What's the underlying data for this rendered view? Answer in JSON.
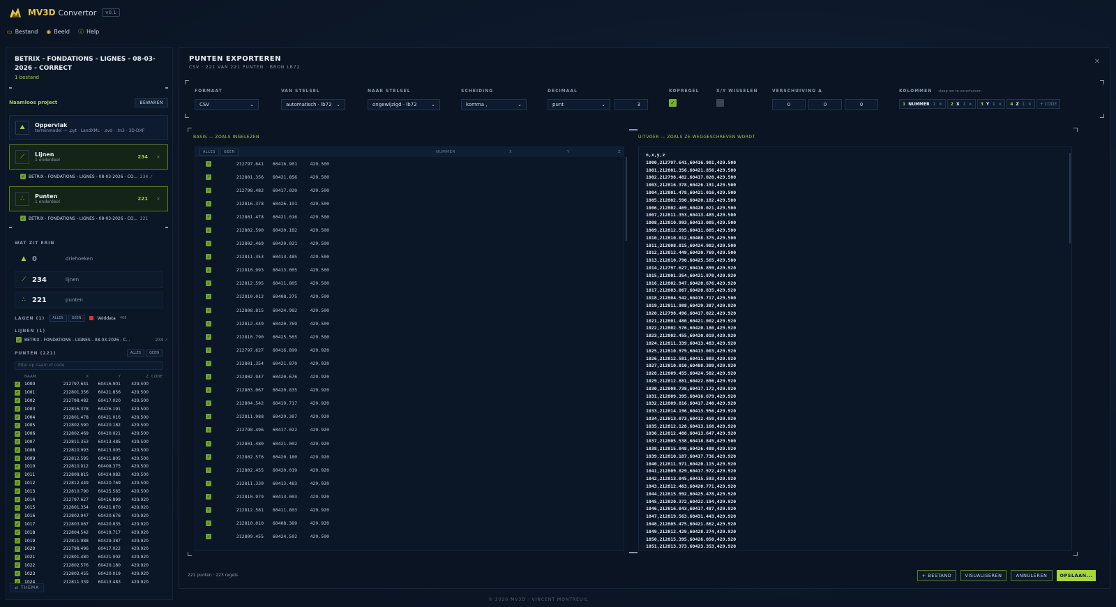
{
  "app": {
    "name_a": "MV3D",
    "name_b": "Convertor",
    "version": "v0.1"
  },
  "menu": [
    {
      "icon": "folder-icon",
      "label": "Bestand"
    },
    {
      "icon": "eye-icon",
      "label": "Beeld"
    },
    {
      "icon": "help-icon",
      "label": "Help"
    }
  ],
  "sidebar": {
    "title": "BETRIX - FONDATIONS - LIGNES - 08-03-2026 - CORRECT",
    "file_count": "1 bestand",
    "project_name": "Naamloos project",
    "save_label": "BEWAREN",
    "cards": [
      {
        "title": "Oppervlak",
        "subtitle": "terreinmodel — .pyt · LandXML · .svd · .tn3 · 3D-DXF",
        "count": "",
        "close": ""
      },
      {
        "title": "Lijnen",
        "subtitle": "1 onderdeel",
        "count": "234",
        "close": "×"
      },
      {
        "title": "Punten",
        "subtitle": "1 onderdeel",
        "count": "221",
        "close": "×"
      }
    ],
    "lijnen_item": {
      "label": "BETRIX - FONDATIONS - LIGNES - 08-03-2026 - CO...",
      "count": "234"
    },
    "punten_item": {
      "label": "BETRIX - FONDATIONS - LIGNES - 08-03-2026 - CO...",
      "count": "221"
    },
    "contents_label": "WAT ZIT ERIN",
    "stats": [
      {
        "value": "0",
        "label": "driehoeken"
      },
      {
        "value": "234",
        "label": "lijnen"
      },
      {
        "value": "221",
        "label": "punten"
      }
    ],
    "layers_label": "LAGEN (1)",
    "all_label": "ALLES",
    "none_label": "GEEN",
    "layer_name": "Velddata",
    "layer_count": "468",
    "lines_section": "LIJNEN (1)",
    "lines_layer": {
      "label": "BETRIX - FONDATIONS - LIGNES - 08-03-2026 - C...",
      "count": "234"
    },
    "points_section": "PUNTEN (221)",
    "filter_placeholder": "filter op naam of code",
    "points_headers": [
      "NAAM",
      "X",
      "Y",
      "Z",
      "CODE"
    ],
    "points_rows": [
      [
        "1000",
        "212797.641",
        "60416.901",
        "429.500"
      ],
      [
        "1001",
        "212801.356",
        "60421.856",
        "429.500"
      ],
      [
        "1002",
        "212798.482",
        "60417.020",
        "429.500"
      ],
      [
        "1003",
        "212816.378",
        "60426.191",
        "429.500"
      ],
      [
        "1004",
        "212801.478",
        "60421.016",
        "429.500"
      ],
      [
        "1005",
        "212802.590",
        "60420.182",
        "429.500"
      ],
      [
        "1006",
        "212802.469",
        "60420.021",
        "429.500"
      ],
      [
        "1007",
        "212811.353",
        "60413.485",
        "429.500"
      ],
      [
        "1008",
        "212810.993",
        "60413.005",
        "429.500"
      ],
      [
        "1009",
        "212812.595",
        "60411.805",
        "429.500"
      ],
      [
        "1010",
        "212810.012",
        "60408.375",
        "429.500"
      ],
      [
        "1011",
        "212808.815",
        "60424.982",
        "429.500"
      ],
      [
        "1012",
        "212812.449",
        "60420.769",
        "429.500"
      ],
      [
        "1013",
        "212810.790",
        "60425.565",
        "429.500"
      ],
      [
        "1014",
        "212797.627",
        "60416.899",
        "429.920"
      ],
      [
        "1015",
        "212801.354",
        "60421.870",
        "429.920"
      ],
      [
        "1016",
        "212802.947",
        "60420.676",
        "429.920"
      ],
      [
        "1017",
        "212803.067",
        "60420.835",
        "429.920"
      ],
      [
        "1018",
        "212804.542",
        "60419.717",
        "429.920"
      ],
      [
        "1019",
        "212811.988",
        "60429.387",
        "429.920"
      ],
      [
        "1020",
        "212798.496",
        "60417.022",
        "429.920"
      ],
      [
        "1021",
        "212801.480",
        "60421.002",
        "429.920"
      ],
      [
        "1022",
        "212802.576",
        "60420.180",
        "429.920"
      ],
      [
        "1023",
        "212802.455",
        "60420.019",
        "429.920"
      ],
      [
        "1024",
        "212811.339",
        "60413.483",
        "429.920"
      ]
    ],
    "theme_label": "THEMA"
  },
  "dialog": {
    "title": "PUNTEN EXPORTEREN",
    "subtitle": "CSV · 221 VAN 221 PUNTEN · BRON LB72",
    "options": {
      "format": {
        "label": "FORMAAT",
        "value": "CSV"
      },
      "from": {
        "label": "VAN STELSEL",
        "value": "automatisch · lb72"
      },
      "to": {
        "label": "NAAR STELSEL",
        "value": "ongewijzigd · lb72"
      },
      "sep": {
        "label": "SCHEIDING",
        "value": "komma ,"
      },
      "decimal": {
        "label": "DECIMAAL",
        "value": "punt",
        "digits": "3"
      },
      "header": {
        "label": "KOPREGEL"
      },
      "swap": {
        "label": "X/Y WISSELEN"
      },
      "offset": {
        "label": "VERSCHUIVING Δ",
        "values": [
          "0",
          "0",
          "0"
        ]
      },
      "columns": {
        "label": "KOLOMMEN",
        "hint": "sleep om te verschuiven",
        "chips": [
          {
            "n": "1",
            "k": "NUMMER"
          },
          {
            "n": "2",
            "k": "X"
          },
          {
            "n": "3",
            "k": "Y"
          },
          {
            "n": "4",
            "k": "Z"
          }
        ],
        "add": "+ CODE"
      }
    },
    "left_label": "BASIS — ZOALS INGELEZEN",
    "right_label": "UITVOER — ZOALS ZE WEGGESCHREVEN WORDT",
    "left_head": {
      "all": "ALLES",
      "none": "GEEN",
      "cols": [
        "NUMMER",
        "X",
        "Y",
        "Z"
      ]
    },
    "left_rows": [
      [
        "212797.641",
        "60416.901",
        "429.500"
      ],
      [
        "212801.356",
        "60421.856",
        "429.500"
      ],
      [
        "212798.482",
        "60417.020",
        "429.500"
      ],
      [
        "212816.378",
        "60426.191",
        "429.500"
      ],
      [
        "212801.478",
        "60421.016",
        "429.500"
      ],
      [
        "212802.590",
        "60420.182",
        "429.500"
      ],
      [
        "212802.469",
        "60420.021",
        "429.500"
      ],
      [
        "212811.353",
        "60413.485",
        "429.500"
      ],
      [
        "212810.993",
        "60413.005",
        "429.500"
      ],
      [
        "212812.595",
        "60411.805",
        "429.500"
      ],
      [
        "212810.012",
        "60408.375",
        "429.500"
      ],
      [
        "212808.815",
        "60424.982",
        "429.500"
      ],
      [
        "212812.449",
        "60420.769",
        "429.500"
      ],
      [
        "212810.790",
        "60425.565",
        "429.500"
      ],
      [
        "212797.627",
        "60416.899",
        "429.920"
      ],
      [
        "212801.354",
        "60421.870",
        "429.920"
      ],
      [
        "212802.947",
        "60420.676",
        "429.920"
      ],
      [
        "212803.067",
        "60420.835",
        "429.920"
      ],
      [
        "212804.542",
        "60419.717",
        "429.920"
      ],
      [
        "212811.988",
        "60429.387",
        "429.920"
      ],
      [
        "212798.496",
        "60417.022",
        "429.920"
      ],
      [
        "212801.480",
        "60421.002",
        "429.920"
      ],
      [
        "212802.576",
        "60420.180",
        "429.920"
      ],
      [
        "212802.455",
        "60420.019",
        "429.920"
      ],
      [
        "212811.339",
        "60413.483",
        "429.920"
      ],
      [
        "212810.979",
        "60413.003",
        "429.920"
      ],
      [
        "212812.581",
        "60411.803",
        "429.920"
      ],
      [
        "212810.010",
        "60408.389",
        "429.920"
      ],
      [
        "212809.455",
        "60424.502",
        "429.500"
      ]
    ],
    "output_text": "n,x,y,z\n1000,212797.641,60416.901,429.500\n1001,212801.356,60421.856,429.500\n1002,212798.482,60417.020,429.500\n1003,212816.378,60426.191,429.500\n1004,212801.478,60421.016,429.500\n1005,212802.590,60420.182,429.500\n1006,212802.469,60420.021,429.500\n1007,212811.353,60413.485,429.500\n1008,212810.993,60413.005,429.500\n1009,212812.595,60411.805,429.500\n1010,212810.012,60408.375,429.500\n1011,212808.815,60424.982,429.500\n1012,212812.449,60420.769,429.500\n1013,212810.790,60425.565,429.500\n1014,212797.627,60416.899,429.920\n1015,212801.354,60421.870,429.920\n1016,212802.947,60420.676,429.920\n1017,212803.067,60420.835,429.920\n1018,212804.542,60419.717,429.500\n1019,212811.988,60429.387,429.920\n1020,212798.496,60417.022,429.920\n1021,212801.480,60421.002,429.920\n1022,212802.576,60420.180,429.920\n1023,212802.455,60420.019,429.920\n1024,212811.339,60413.483,429.920\n1025,212810.979,60413.003,429.920\n1026,212812.581,60411.803,429.920\n1027,212810.010,60408.389,429.920\n1028,212809.455,60424.502,429.920\n1029,212812.881,60422.696,429.920\n1030,212808.738,60417.172,429.920\n1031,212809.395,60416.679,429.920\n1032,212809.816,60417.240,429.920\n1033,212814.196,60413.956,429.920\n1034,212813.073,60412.459,429.920\n1035,212812.128,60413.168,429.920\n1036,212812.488,60413.647,429.920\n1037,212805.538,60418.845,429.500\n1038,212815.848,60426.488,429.920\n1039,212810.187,60417.736,429.920\n1040,212811.971,60420.115,429.920\n1041,212809.829,60417.972,429.920\n1042,212813.045,60415.593,429.920\n1043,212812.463,60420.771,429.920\n1044,212815.992,60425.478,429.920\n1045,212820.372,60422.194,429.920\n1046,212816.843,60417.487,429.920\n1047,212819.563,60431.443,429.920\n1048,212805.475,60421.862,429.920\n1049,212812.429,60428.274,429.920\n1050,212815.395,60426.050,429.920\n1051,212813.373,60423.353,429.920",
    "footer_count": "221 punten · 223 regels",
    "buttons": {
      "bestand": "+ BESTAND",
      "visualiseren": "VISUALISEREN",
      "annuleren": "ANNULEREN",
      "opslaan": "OPSLAAN..."
    }
  },
  "copyright": "© 2026 MV3D · VINCENT MONTREUIL",
  "colors": {
    "accent": "#a8d63a",
    "brand": "#e6c34a",
    "background": "#0b1526",
    "layer_swatch": "#d23a3a"
  }
}
